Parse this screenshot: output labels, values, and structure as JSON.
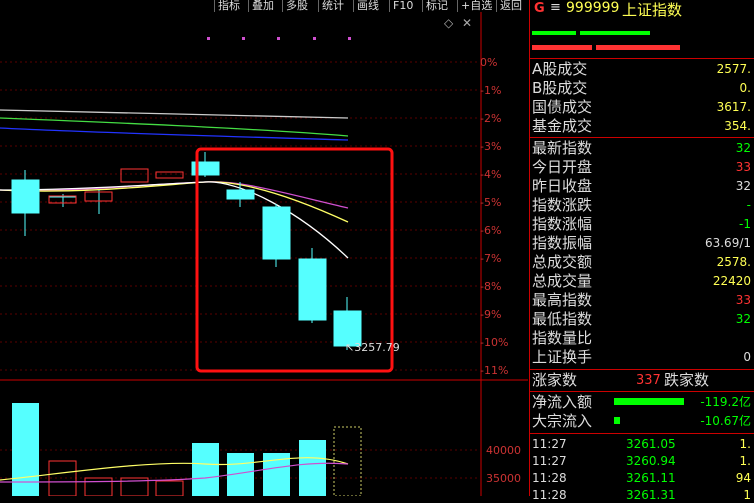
{
  "toolbar": {
    "items": [
      "指标",
      "叠加",
      "多股",
      "统计",
      "画线",
      "F10",
      "标记",
      "+自选",
      "返回"
    ]
  },
  "chart": {
    "pct_labels": [
      "0%",
      "-1%",
      "-2%",
      "-3%",
      "-4%",
      "-5%",
      "-6%",
      "-7%",
      "-8%",
      "-9%",
      "-10%",
      "-11%"
    ],
    "low_annotation": "3257.79",
    "volume_labels": [
      "40000",
      "35000"
    ],
    "icons": {
      "diamond": "◇",
      "close": "✕"
    }
  },
  "panel": {
    "header": {
      "market_icon": "G",
      "menu_icon": "≡",
      "code": "999999",
      "name": "上证指数"
    },
    "stats": [
      {
        "label": "A股成交",
        "value": "2577."
      },
      {
        "label": "B股成交",
        "value": "0."
      },
      {
        "label": "国债成交",
        "value": "3617."
      },
      {
        "label": "基金成交",
        "value": "354."
      },
      {
        "label": "最新指数",
        "value": "32"
      },
      {
        "label": "今日开盘",
        "value": "33"
      },
      {
        "label": "昨日收盘",
        "value": "32"
      },
      {
        "label": "指数涨跌",
        "value": "-"
      },
      {
        "label": "指数涨幅",
        "value": "-1"
      },
      {
        "label": "指数振幅",
        "value": "63.69/1"
      },
      {
        "label": "总成交额",
        "value": "2578."
      },
      {
        "label": "总成交量",
        "value": "22420"
      },
      {
        "label": "最高指数",
        "value": "33"
      },
      {
        "label": "最低指数",
        "value": "32"
      },
      {
        "label": "指数量比",
        "value": ""
      },
      {
        "label": "上证换手",
        "value": "0"
      }
    ],
    "breadth": {
      "up_label": "涨家数",
      "up_count": "337",
      "down_label": "跌家数"
    },
    "flows": [
      {
        "label": "净流入额",
        "value": "-119.2亿"
      },
      {
        "label": "大宗流入",
        "value": "-10.67亿"
      }
    ],
    "ticks": [
      {
        "time": "11:27",
        "price": "3261.05",
        "vol": "1."
      },
      {
        "time": "11:27",
        "price": "3260.94",
        "vol": "1."
      },
      {
        "time": "11:28",
        "price": "3261.11",
        "vol": "94"
      },
      {
        "time": "11:28",
        "price": "3261.31",
        "vol": "1"
      }
    ],
    "colors": {
      "up": "#ff3333",
      "down": "#00ff00",
      "border": "#c00000",
      "label": "#dddddd",
      "value": "#ffff54"
    }
  }
}
